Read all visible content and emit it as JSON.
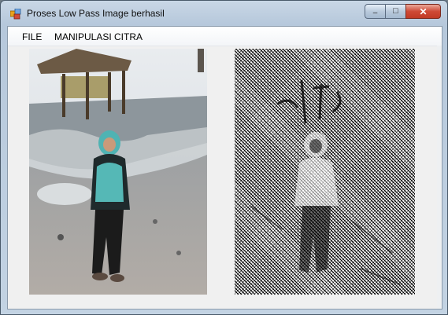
{
  "window": {
    "title": "Proses Low Pass Image berhasil",
    "close_glyph": "✕",
    "minimize_glyph": "–",
    "maximize_glyph": "□"
  },
  "menu": {
    "items": [
      {
        "label": "FILE"
      },
      {
        "label": "MANIPULASI CITRA"
      }
    ]
  },
  "images": {
    "original": {
      "icon": "photo-beach-girl"
    },
    "filtered": {
      "icon": "photo-low-pass-result"
    }
  },
  "colors": {
    "close_button": "#c13a24",
    "client_bg": "#f0f0f0"
  }
}
